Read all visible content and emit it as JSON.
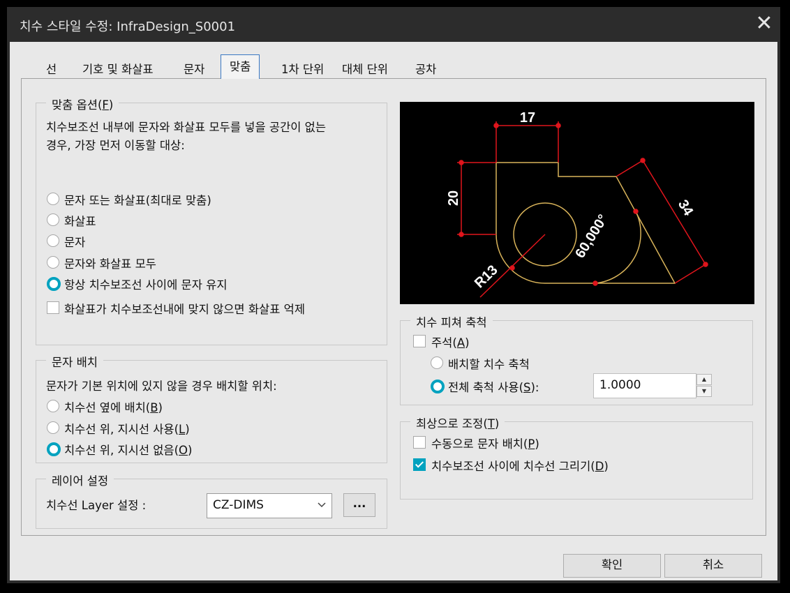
{
  "window": {
    "title": "치수 스타일 수정: InfraDesign_S0001",
    "close_glyph": "✕"
  },
  "tabs": [
    {
      "label": "선"
    },
    {
      "label": "기호 및 화살표"
    },
    {
      "label": "문자"
    },
    {
      "label": "맞춤",
      "active": true
    },
    {
      "label": "1차 단위"
    },
    {
      "label": "대체 단위"
    },
    {
      "label": "공차"
    }
  ],
  "fit_options": {
    "label_prefix": "맞춤 옵션(",
    "label_key": "F",
    "label_suffix": ")",
    "desc_line1": "치수보조선 내부에 문자와 화살표 모두를 넣을 공간이 없는",
    "desc_line2": "경우, 가장 먼저 이동할 대상:",
    "radios": [
      {
        "label": "문자 또는 화살표(최대로 맞춤)",
        "selected": false
      },
      {
        "label": "화살표",
        "selected": false
      },
      {
        "label": "문자",
        "selected": false
      },
      {
        "label": "문자와 화살표 모두",
        "selected": false
      },
      {
        "label": "항상 치수보조선 사이에 문자 유지",
        "selected": true
      }
    ],
    "suppress_arrows": {
      "label": "화살표가 치수보조선내에 맞지 않으면 화살표 억제",
      "checked": false
    }
  },
  "text_placement": {
    "label": "문자 배치",
    "desc": "문자가 기본 위치에 있지 않을 경우 배치할 위치:",
    "radios": [
      {
        "prefix": "치수선 옆에 배치(",
        "key": "B",
        "suffix": ")",
        "selected": false
      },
      {
        "prefix": "치수선 위, 지시선 사용(",
        "key": "L",
        "suffix": ")",
        "selected": false
      },
      {
        "prefix": "치수선 위, 지시선 없음(",
        "key": "O",
        "suffix": ")",
        "selected": true
      }
    ]
  },
  "layer_settings": {
    "label": "레이어 설정",
    "field_label": "치수선 Layer 설정 :",
    "selected": "CZ-DIMS",
    "browse_label": "..."
  },
  "preview": {
    "dim_17": "17",
    "dim_20": "20",
    "dim_34": "34",
    "dim_angle": "60,000°",
    "dim_radius": "R13",
    "colors": {
      "geometry": "#d9b45a",
      "dimension": "#e0151c",
      "text": "#ffffff",
      "background": "#000000"
    }
  },
  "scale": {
    "label": "치수 피쳐 축척",
    "annotative": {
      "prefix": "주석(",
      "key": "A",
      "suffix": ")",
      "checked": false
    },
    "scale_to_layout": {
      "label": "배치할 치수 축척",
      "selected": false
    },
    "overall": {
      "prefix": "전체 축척 사용(",
      "key": "S",
      "suffix": "):",
      "selected": true
    },
    "value": "1.0000"
  },
  "fine_tuning": {
    "prefix": "최상으로 조정(",
    "key": "T",
    "suffix": ")",
    "manual": {
      "prefix": "수동으로 문자 배치(",
      "key": "P",
      "suffix": ")",
      "checked": false
    },
    "draw_between": {
      "prefix": "치수보조선 사이에 치수선 그리기(",
      "key": "D",
      "suffix": ")",
      "checked": true
    }
  },
  "buttons": {
    "ok": "확인",
    "cancel": "취소"
  },
  "accent_color": "#00a2bf"
}
